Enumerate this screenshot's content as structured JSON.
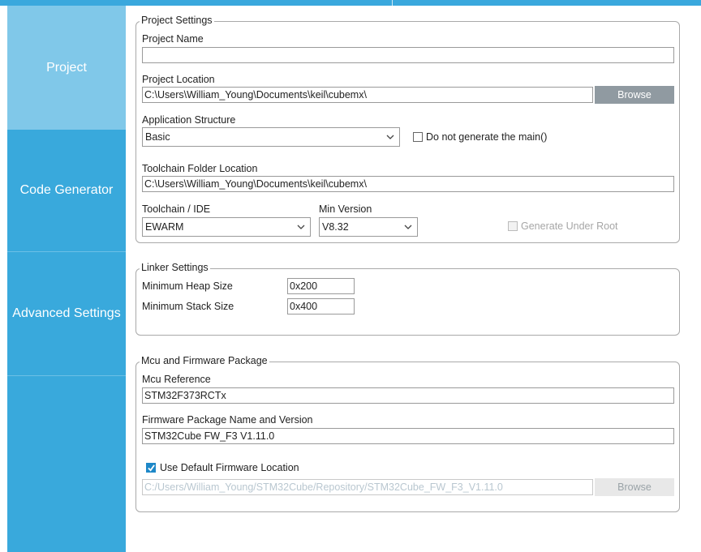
{
  "sidebar": {
    "tabs": [
      {
        "label": "Project",
        "active": true
      },
      {
        "label": "Code Generator",
        "active": false
      },
      {
        "label": "Advanced Settings",
        "active": false
      }
    ]
  },
  "project_settings": {
    "legend": "Project Settings",
    "project_name_label": "Project Name",
    "project_name_value": "",
    "project_location_label": "Project Location",
    "project_location_value": "C:\\Users\\William_Young\\Documents\\keil\\cubemx\\",
    "browse_label": "Browse",
    "app_structure_label": "Application Structure",
    "app_structure_value": "Basic",
    "no_main_label": "Do not generate the main()",
    "no_main_checked": false,
    "toolchain_folder_label": "Toolchain Folder Location",
    "toolchain_folder_value": "C:\\Users\\William_Young\\Documents\\keil\\cubemx\\",
    "toolchain_label": "Toolchain / IDE",
    "toolchain_value": "EWARM",
    "min_version_label": "Min Version",
    "min_version_value": "V8.32",
    "gen_under_root_label": "Generate Under Root",
    "gen_under_root_checked": false
  },
  "linker_settings": {
    "legend": "Linker Settings",
    "heap_label": "Minimum Heap Size",
    "heap_value": "0x200",
    "stack_label": "Minimum Stack Size",
    "stack_value": "0x400"
  },
  "mcu_firmware": {
    "legend": "Mcu and Firmware Package",
    "mcu_ref_label": "Mcu Reference",
    "mcu_ref_value": "STM32F373RCTx",
    "fw_name_label": "Firmware Package Name and Version",
    "fw_name_value": "STM32Cube FW_F3 V1.11.0",
    "use_default_label": "Use Default Firmware Location",
    "use_default_checked": true,
    "fw_location_value": "C:/Users/William_Young/STM32Cube/Repository/STM32Cube_FW_F3_V1.11.0",
    "browse_label": "Browse"
  },
  "colors": {
    "sidebar": "#39a9dc",
    "sidebar_active": "#80c8e9",
    "accent_check": "#1e88c8"
  }
}
